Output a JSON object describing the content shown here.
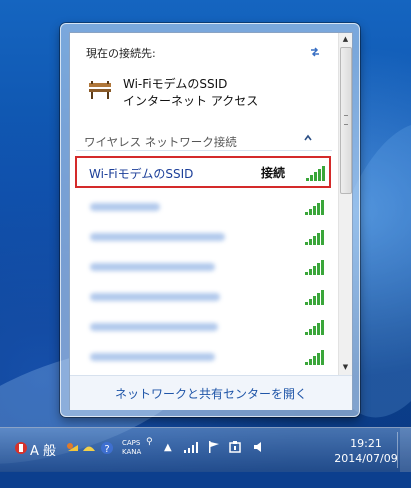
{
  "flyout": {
    "current_connection_label": "現在の接続先:",
    "connected_network": {
      "ssid": "Wi-FiモデムのSSID",
      "access_type": "インターネット アクセス"
    },
    "section_title": "ワイヤレス ネットワーク接続",
    "networks": [
      {
        "name": "Wi-FiモデムのSSID",
        "status": "接続",
        "selected": true,
        "signal": 5
      },
      {
        "name": "",
        "status": "",
        "selected": false,
        "signal": 5
      },
      {
        "name": "",
        "status": "",
        "selected": false,
        "signal": 5
      },
      {
        "name": "",
        "status": "",
        "selected": false,
        "signal": 5
      },
      {
        "name": "",
        "status": "",
        "selected": false,
        "signal": 5
      },
      {
        "name": "",
        "status": "",
        "selected": false,
        "signal": 5
      },
      {
        "name": "",
        "status": "",
        "selected": false,
        "signal": 5
      },
      {
        "name": "",
        "status": "",
        "selected": false,
        "signal": 5
      }
    ],
    "footer_link": "ネットワークと共有センターを開く"
  },
  "taskbar": {
    "ime_mode": "A 般",
    "caps_label": "CAPS",
    "kana_label": "KANA",
    "clock_time": "19:21",
    "clock_date": "2014/07/09"
  },
  "icons": {
    "refresh": "refresh-icon",
    "connection": "network-bench-icon",
    "signal": "wifi-signal-icon"
  },
  "colors": {
    "selected_border": "#d42a2a",
    "link": "#1f55a8",
    "signal_green": "#3aa63a"
  }
}
